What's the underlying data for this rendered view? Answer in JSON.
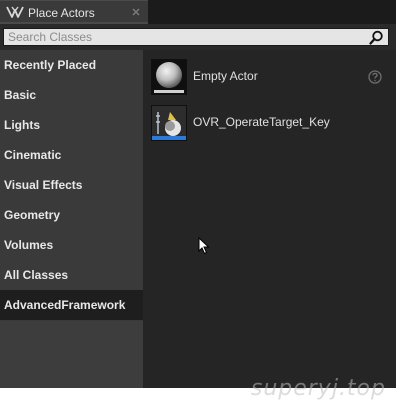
{
  "tab": {
    "title": "Place Actors",
    "icon": "place-actors-icon",
    "close_icon": "close-icon"
  },
  "search": {
    "placeholder": "Search Classes",
    "value": "",
    "icon": "search-icon"
  },
  "sidebar": {
    "items": [
      {
        "label": "Recently Placed",
        "selected": false
      },
      {
        "label": "Basic",
        "selected": false
      },
      {
        "label": "Lights",
        "selected": false
      },
      {
        "label": "Cinematic",
        "selected": false
      },
      {
        "label": "Visual Effects",
        "selected": false
      },
      {
        "label": "Geometry",
        "selected": false
      },
      {
        "label": "Volumes",
        "selected": false
      },
      {
        "label": "All Classes",
        "selected": false
      },
      {
        "label": "AdvancedFramework",
        "selected": true
      }
    ]
  },
  "list": {
    "items": [
      {
        "label": "Empty Actor",
        "icon": "sphere-thumbnail-icon",
        "has_help": true
      },
      {
        "label": "OVR_OperateTarget_Key",
        "icon": "blueprint-thumbnail-icon",
        "has_help": false
      }
    ]
  },
  "watermark": "superyj.top",
  "colors": {
    "panel_bg": "#242424",
    "sidebar_bg": "#3a3a3a",
    "selected_bg": "#1e1e1e",
    "search_bg": "#e5e5e5",
    "accent_blue": "#2a7ad6"
  }
}
